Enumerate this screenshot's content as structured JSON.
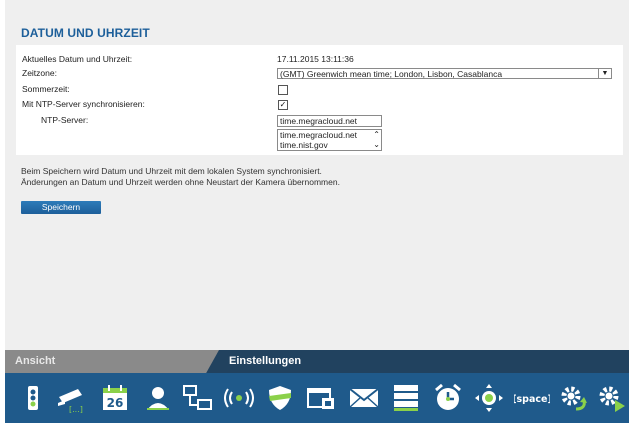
{
  "page": {
    "title": "DATUM UND UHRZEIT"
  },
  "form": {
    "current_label": "Aktuelles Datum und Uhrzeit:",
    "current_value": "17.11.2015 13:11:36",
    "timezone_label": "Zeitzone:",
    "timezone_value": "(GMT) Greenwich mean time; London, Lisbon, Casablanca",
    "dst_label": "Sommerzeit:",
    "dst_checked": false,
    "ntp_sync_label": "Mit NTP-Server synchronisieren:",
    "ntp_sync_checked": true,
    "ntp_server_label": "NTP-Server:",
    "ntp_server_value": "time.megracloud.net",
    "ntp_server_options": [
      "time.megracloud.net",
      "time.nist.gov"
    ]
  },
  "notes": {
    "line1": "Beim Speichern wird Datum und Uhrzeit mit dem lokalen System synchronisiert.",
    "line2": "Änderungen an Datum und Uhrzeit werden ohne Neustart der Kamera übernommen."
  },
  "save_label": "Speichern",
  "tabs": {
    "view": "Ansicht",
    "settings": "Einstellungen"
  },
  "toolbar": {
    "icons": [
      "traffic-light-icon",
      "camera-icon",
      "calendar-icon",
      "user-icon",
      "network-icon",
      "wireless-icon",
      "shield-icon",
      "window-icon",
      "mail-icon",
      "storage-icon",
      "alarm-clock-icon",
      "ptz-icon",
      "space-icon",
      "gear-refresh-icon",
      "gear-play-icon"
    ],
    "calendar_day": "26",
    "space_text": "[space]"
  },
  "colors": {
    "accent": "#1d5f9a",
    "tabbar": "#21425f",
    "toolbar": "#1f5a8b",
    "icon_green": "#8bd14a"
  }
}
